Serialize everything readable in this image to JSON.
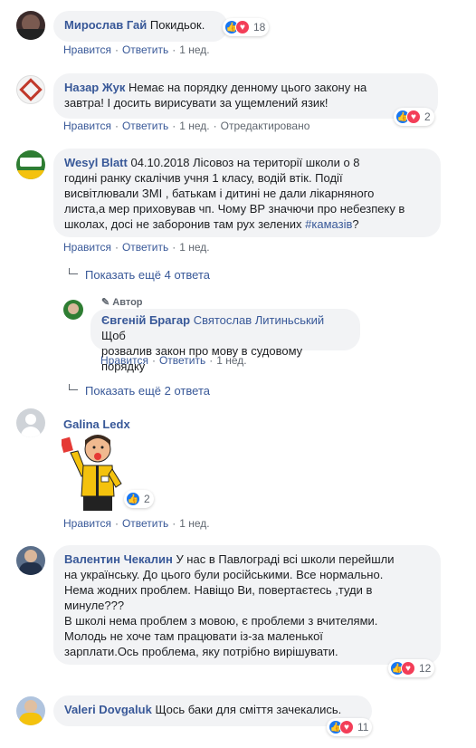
{
  "c1": {
    "name": "Мирослав Гай",
    "text": "Покидьок.",
    "count": "18",
    "like": "Нравится",
    "reply": "Ответить",
    "time": "1 нед."
  },
  "c2": {
    "name": "Назар Жук",
    "text1": "Немає на порядку денному цього закону на",
    "text2": "завтра! І досить вирисувати за ущемлений язик!",
    "count": "2",
    "like": "Нравится",
    "reply": "Ответить",
    "time": "1 нед.",
    "edited": "Отредактировано"
  },
  "c3": {
    "name": "Wesyl Blatt",
    "text1": "04.10.2018 Лісовоз на території школи о 8",
    "text2": "годині ранку скалічив учня 1 класу, водій втік. Події",
    "text3": "висвітлювали ЗМІ , батькам і дитині не дали лікарняного",
    "text4": "листа,а мер приховував чп. Чому ВР значючи про небезпеку в",
    "text5": "школах, досі не заборонив там рух зелених",
    "hashtag": "#камазів",
    "text5b": "?",
    "like": "Нравится",
    "reply": "Ответить",
    "time": "1 нед."
  },
  "more1": "Показать ещё 4 ответа",
  "r1": {
    "author": "Автор",
    "name": "Євгеній Брагар",
    "mention": "Святослав Литиньський",
    "text1": "Щоб",
    "text2": "розвалив закон про мову в судовому порядку",
    "like": "Нравится",
    "reply": "Ответить",
    "time": "1 нед."
  },
  "more2": "Показать ещё 2 ответа",
  "c4": {
    "name": "Galina Ledx",
    "count": "2",
    "like": "Нравится",
    "reply": "Ответить",
    "time": "1 нед."
  },
  "c5": {
    "name": "Валентин Чекалин",
    "text1": "У нас в Павлограді всі школи перейшли",
    "text2": "на українську. До цього були російськими. Все нормально.",
    "text3": "Нема жодних проблем. Навіщо Ви, повертаєтесь ,туди в",
    "text4": "минуле???",
    "text5": "В школі нема проблем з мовою, є проблеми з вчителями.",
    "text6": "Молодь не хоче там працювати із-за маленької",
    "text7": "зарплати.Ось проблема, яку потрібно вирішувати.",
    "count": "12"
  },
  "c6": {
    "name": "Valeri Dovgaluk",
    "text": "Щось баки для сміття зачекались.",
    "count": "11"
  },
  "icons": {
    "like": "thumbs-up-icon",
    "love": "heart-icon",
    "arrow": "reply-arrow-icon",
    "pencil": "pencil-icon"
  },
  "colors": {
    "link": "#385898",
    "bubble": "#f2f3f5",
    "like": "#1877f2",
    "love": "#f33e58"
  }
}
